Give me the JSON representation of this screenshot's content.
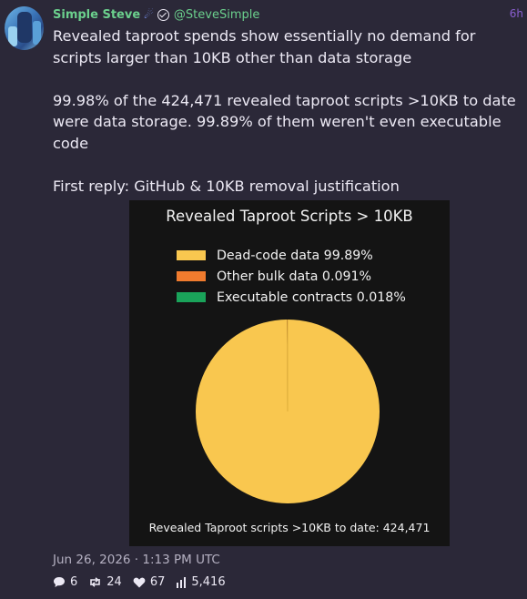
{
  "post": {
    "display_name": "Simple Steve",
    "name_emoji": "☄",
    "handle": "@SteveSimple",
    "relative_time": "6h",
    "paragraphs": [
      "Revealed taproot spends show essentially no demand for scripts larger than 10KB other than data storage",
      "99.98% of the 424,471 revealed taproot scripts >10KB to date were data storage. 99.89% of them weren't even executable code",
      "First reply: GitHub & 10KB removal justification"
    ],
    "datetime": "Jun 26, 2026 · 1:13 PM UTC",
    "stats": {
      "replies": "6",
      "reposts": "24",
      "likes": "67",
      "views": "5,416"
    }
  },
  "chart_data": {
    "type": "pie",
    "title": "Revealed Taproot Scripts > 10KB",
    "slices": [
      {
        "label": "Dead-code data  99.89%",
        "value": 99.89,
        "color": "#f9c74f"
      },
      {
        "label": "Other bulk data  0.091%",
        "value": 0.091,
        "color": "#f07b2e"
      },
      {
        "label": "Executable contracts  0.018%",
        "value": 0.018,
        "color": "#1aa35a"
      }
    ],
    "footer": "Revealed Taproot scripts >10KB to date: 424,471",
    "legend_position": "top",
    "background": "#141414"
  },
  "icons": {
    "reply": "speech-bubble-icon",
    "repost": "repost-arrows-icon",
    "like": "heart-icon",
    "views": "bar-chart-icon"
  },
  "colors": {
    "accent": "#6bd08d",
    "background": "#2b2838",
    "relative_time": "#8a5fd0"
  }
}
